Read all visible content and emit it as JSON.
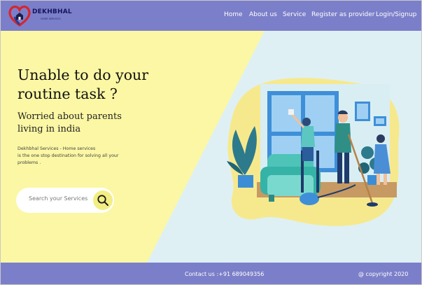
{
  "brand": {
    "name": "DEKHBHAL",
    "tagline": "HOME SERVICES"
  },
  "nav": {
    "items": [
      {
        "label": "Home"
      },
      {
        "label": "About us"
      },
      {
        "label": "Service"
      },
      {
        "label": "Register as provider"
      },
      {
        "label": "Login/Signup"
      }
    ]
  },
  "hero": {
    "headline_line1": "Unable to do your",
    "headline_line2": "routine task ?",
    "subhead_line1": "Worried about parents",
    "subhead_line2": "living in india",
    "desc_line1": "Dekhbhal Services - Home services",
    "desc_line2": "is the one stop destination for solving all your",
    "desc_line3": "problems .",
    "search_placeholder": "Search your Services",
    "illustration": "home-cleaning-illustration"
  },
  "footer": {
    "contact": "Contact us :+91 689049356",
    "copyright": "@ copyright 2020"
  },
  "colors": {
    "nav_bg": "#7b7fc9",
    "hero_yellow": "#fbf7a4",
    "hero_blue": "#dff0f4",
    "blob_yellow": "#f6e98d",
    "accent_button": "#f3ee84"
  },
  "icons": [
    "logo-heart-icon",
    "house-icon",
    "search-icon"
  ]
}
